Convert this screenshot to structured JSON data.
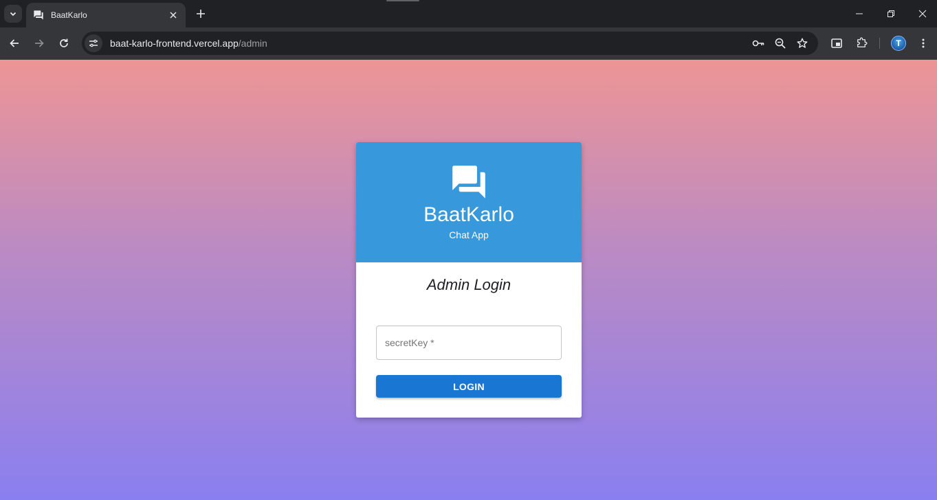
{
  "browser": {
    "tab": {
      "title": "BaatKarlo",
      "favicon": "chat-bubbles-icon"
    },
    "url": {
      "host": "baat-karlo-frontend.vercel.app",
      "path": "/admin"
    },
    "avatar_initial": "T"
  },
  "colors": {
    "header_blue": "#3798db",
    "button_blue": "#1976d2",
    "gradient_top": "#ed9595",
    "gradient_bottom": "#8a7ff0"
  },
  "card": {
    "logo_icon": "chat-bubbles-icon",
    "brand": "BaatKarlo",
    "tagline": "Chat App",
    "form_title": "Admin Login",
    "secret_key": {
      "placeholder": "secretKey *",
      "value": ""
    },
    "login_label": "LOGIN"
  }
}
